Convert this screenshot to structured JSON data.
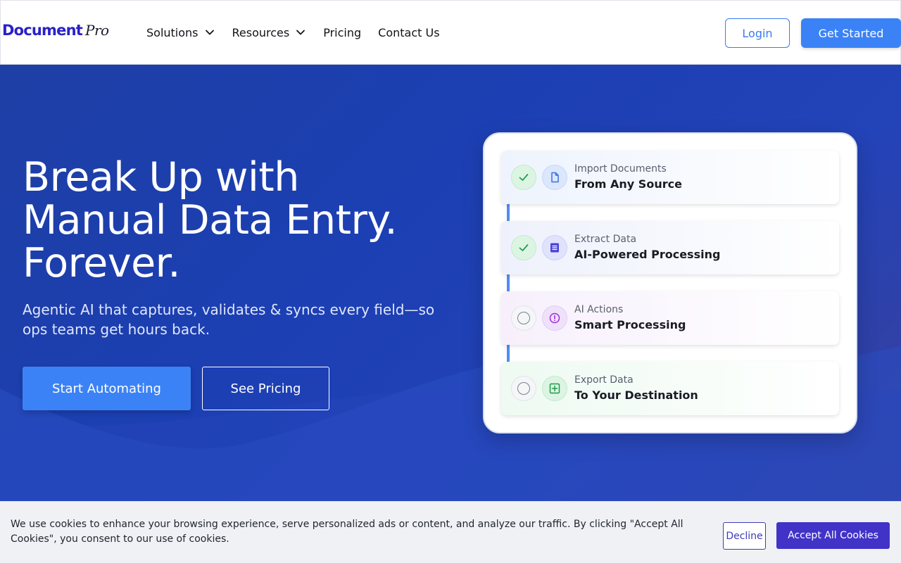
{
  "header": {
    "logo_main": "Document",
    "logo_script": "Pro",
    "nav": [
      {
        "label": "Solutions",
        "has_dropdown": true
      },
      {
        "label": "Resources",
        "has_dropdown": true
      },
      {
        "label": "Pricing",
        "has_dropdown": false
      },
      {
        "label": "Contact Us",
        "has_dropdown": false
      }
    ],
    "login_label": "Login",
    "get_started_label": "Get Started"
  },
  "hero": {
    "title_lines": [
      "Break Up with",
      "Manual Data Entry.",
      "Forever."
    ],
    "subtitle": "Agentic AI that captures, validates & syncs every field—so ops teams get hours back.",
    "primary_cta": "Start Automating",
    "secondary_cta": "See Pricing"
  },
  "workflow": {
    "steps": [
      {
        "label": "Import Documents",
        "title": "From Any Source",
        "status": "done",
        "icon": "document-icon"
      },
      {
        "label": "Extract Data",
        "title": "AI-Powered Processing",
        "status": "done",
        "icon": "list-icon"
      },
      {
        "label": "AI Actions",
        "title": "Smart Processing",
        "status": "pending",
        "icon": "alert-icon"
      },
      {
        "label": "Export Data",
        "title": "To Your Destination",
        "status": "pending",
        "icon": "plus-square-icon"
      }
    ]
  },
  "cookie": {
    "text": "We use cookies to enhance your browsing experience, serve personalized ads or content, and analyze our traffic. By clicking \"Accept All Cookies\", you consent to our use of cookies.",
    "decline_label": "Decline",
    "accept_label": "Accept All Cookies"
  },
  "colors": {
    "brand": "#2a21c7",
    "primary": "#3b82f6",
    "hero_bg": "#1e3fa5",
    "accept": "#4133c7"
  }
}
